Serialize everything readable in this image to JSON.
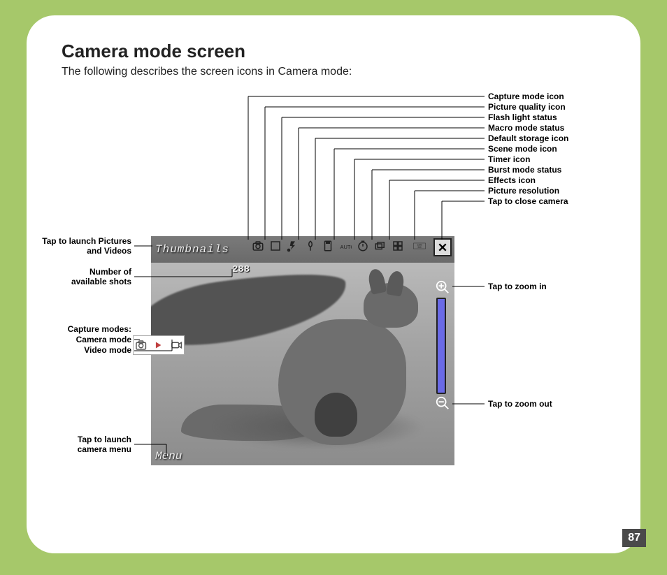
{
  "page": {
    "title": "Camera mode screen",
    "subtitle": "The following describes the screen icons in Camera mode:",
    "number": "87"
  },
  "labels_right": [
    "Capture mode icon",
    "Picture quality icon",
    "Flash light status",
    "Macro mode status",
    "Default storage icon",
    "Scene mode icon",
    "Timer icon",
    "Burst mode status",
    "Effects icon",
    "Picture resolution",
    "Tap to close camera"
  ],
  "labels_left": {
    "thumbnails": "Tap to launch Pictures\nand Videos",
    "shots": "Number of\navailable shots",
    "modes_header": "Capture modes:",
    "camera_mode": "Camera mode",
    "video_mode": "Video mode",
    "menu": "Tap to launch\ncamera menu"
  },
  "labels_zoom": {
    "in": "Tap to zoom in",
    "out": "Tap to zoom out"
  },
  "screen": {
    "thumbnails_label": "Thumbnails",
    "available_shots": "288",
    "menu_label": "Menu",
    "resolution_text": "1280\n960"
  }
}
